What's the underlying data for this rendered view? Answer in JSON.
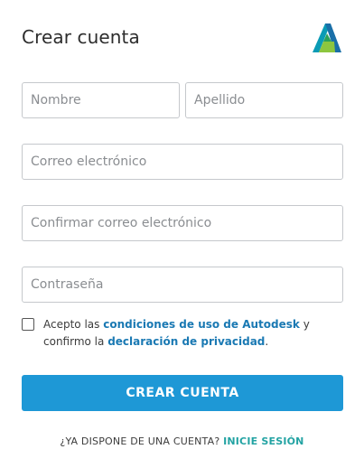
{
  "header": {
    "title": "Crear cuenta",
    "logo_icon": "autodesk-logo-icon"
  },
  "form": {
    "first_name_placeholder": "Nombre",
    "last_name_placeholder": "Apellido",
    "email_placeholder": "Correo electrónico",
    "confirm_email_placeholder": "Confirmar correo electrónico",
    "password_placeholder": "Contraseña",
    "terms": {
      "prefix": "Acepto las ",
      "terms_link": "condiciones de uso de Autodesk",
      "middle": " y confirmo la ",
      "privacy_link": "declaración de privacidad",
      "suffix": "."
    },
    "submit_label": "CREAR CUENTA"
  },
  "footer": {
    "question": "¿YA DISPONE DE UNA CUENTA?",
    "signin_link": "INICIE SESIÓN"
  },
  "colors": {
    "primary_button": "#1e98d6",
    "link": "#1a79b3",
    "signin_link": "#23a3a3"
  }
}
